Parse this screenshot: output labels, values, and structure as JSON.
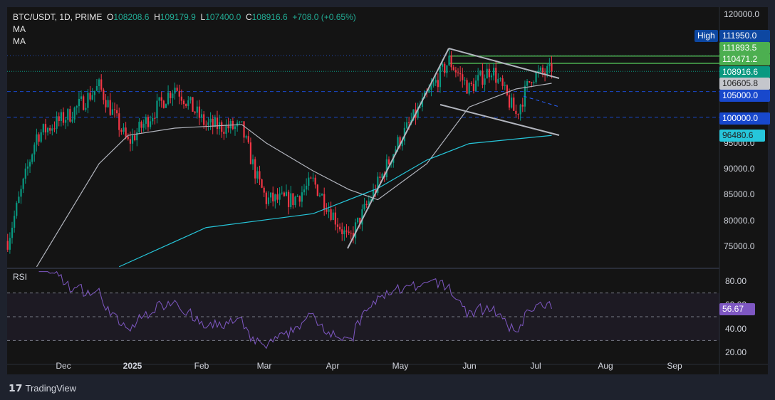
{
  "header": {
    "symbol": "BTC/USDT, 1D, PRIME",
    "o_label": "O",
    "o": "108208.6",
    "h_label": "H",
    "h": "109179.9",
    "l_label": "L",
    "l": "107400.0",
    "c_label": "C",
    "c": "108916.6",
    "change": "+708.0 (+0.65%)",
    "ma1": "MA",
    "ma2": "MA"
  },
  "price_axis": [
    "120000.0",
    "95000.0",
    "90000.0",
    "85000.0",
    "80000.0",
    "75000.0"
  ],
  "price_tags": {
    "high_label": "High",
    "high": "111950.0",
    "g1": "111893.5",
    "g2": "110471.2",
    "last": "108916.6",
    "ma_fast": "106605.8",
    "lvl105": "105000.0",
    "lvl100": "100000.0",
    "ma_slow": "96480.6"
  },
  "rsi": {
    "label": "RSI",
    "value": "56.67",
    "axis": [
      "80.00",
      "60.00",
      "40.00",
      "20.00"
    ]
  },
  "time_axis": [
    "Dec",
    "2025",
    "Feb",
    "Mar",
    "Apr",
    "May",
    "Jun",
    "Jul",
    "Aug",
    "Sep"
  ],
  "brand": "TradingView",
  "colors": {
    "up": "#089981",
    "down": "#f23645",
    "ma_fast": "#b2b5be",
    "ma_slow": "#26c6da",
    "rsi": "#7e57c2"
  },
  "chart_data": {
    "type": "candlestick",
    "close_path": [
      [
        "2024-11-06",
        76000
      ],
      [
        "2024-11-19",
        96500
      ],
      [
        "2024-12-04",
        100600
      ],
      [
        "2024-12-17",
        106000
      ],
      [
        "2024-12-30",
        95000
      ],
      [
        "2025-01-20",
        106000
      ],
      [
        "2025-02-03",
        98500
      ],
      [
        "2025-02-19",
        97800
      ],
      [
        "2025-02-26",
        88000
      ],
      [
        "2025-03-02",
        84000
      ],
      [
        "2025-03-14",
        84000
      ],
      [
        "2025-03-23",
        87500
      ],
      [
        "2025-04-08",
        76000
      ],
      [
        "2025-04-21",
        87000
      ],
      [
        "2025-04-30",
        95000
      ],
      [
        "2025-05-13",
        104000
      ],
      [
        "2025-05-23",
        111000
      ],
      [
        "2025-06-01",
        105500
      ],
      [
        "2025-06-11",
        109500
      ],
      [
        "2025-06-22",
        100500
      ],
      [
        "2025-06-29",
        108000
      ],
      [
        "2025-07-08",
        108916.6
      ]
    ],
    "ma_fast": [
      [
        "2024-11-19",
        71000
      ],
      [
        "2024-12-17",
        91000
      ],
      [
        "2024-12-30",
        96500
      ],
      [
        "2025-01-20",
        97900
      ],
      [
        "2025-02-19",
        98600
      ],
      [
        "2025-03-02",
        95000
      ],
      [
        "2025-03-23",
        89600
      ],
      [
        "2025-04-08",
        86000
      ],
      [
        "2025-04-21",
        84000
      ],
      [
        "2025-05-13",
        91000
      ],
      [
        "2025-06-01",
        102000
      ],
      [
        "2025-06-22",
        105500
      ],
      [
        "2025-07-08",
        106605.8
      ]
    ],
    "ma_slow": [
      [
        "2024-12-26",
        71000
      ],
      [
        "2025-02-03",
        78600
      ],
      [
        "2025-03-23",
        81300
      ],
      [
        "2025-04-21",
        86200
      ],
      [
        "2025-05-13",
        91700
      ],
      [
        "2025-06-01",
        94900
      ],
      [
        "2025-07-08",
        96480.6
      ]
    ],
    "levels": {
      "high": 111950,
      "g1": 111893.5,
      "g2": 110471.2,
      "last": 108916.6,
      "l105": 105000,
      "l100": 100000
    },
    "ylim": [
      72000,
      122700
    ],
    "rsi_lim": [
      15,
      88
    ]
  }
}
